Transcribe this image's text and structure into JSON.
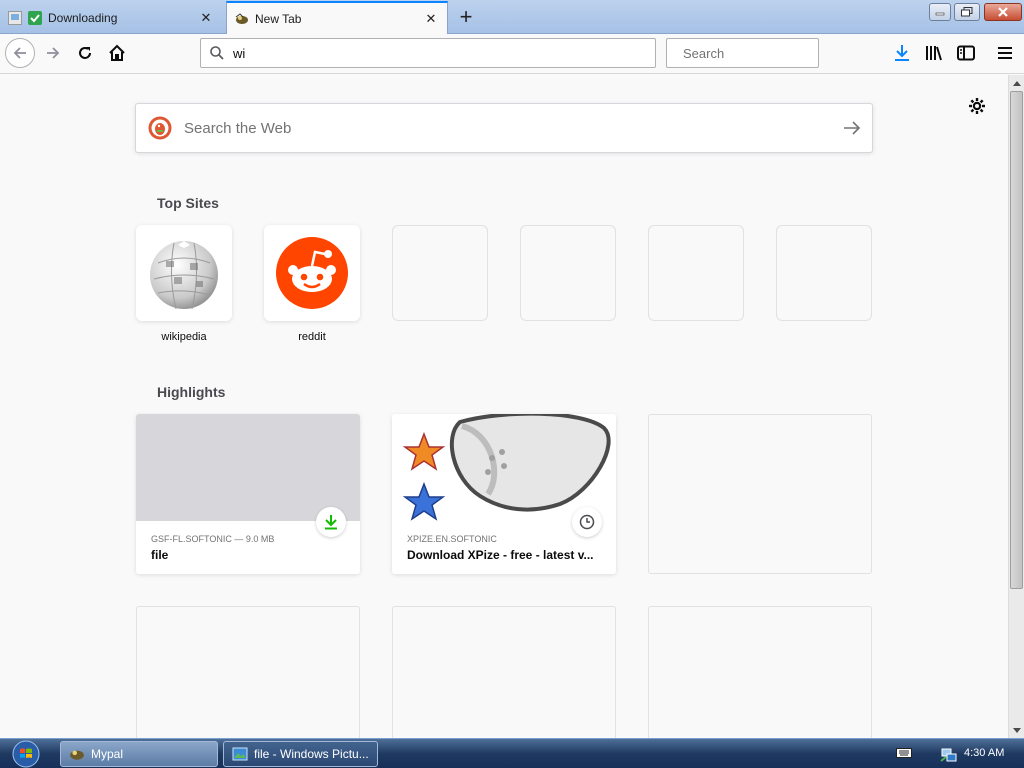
{
  "browser": {
    "tabs": [
      {
        "label": "Downloading",
        "close": "✕"
      },
      {
        "label": "New Tab",
        "close": "✕"
      }
    ],
    "new_tab_glyph": "+",
    "url_value": "wi",
    "search_placeholder": "Search",
    "accent": "#0a84ff"
  },
  "page": {
    "web_search_placeholder": "Search the Web",
    "topsites_title": "Top Sites",
    "topsites": [
      {
        "label": "wikipedia",
        "icon": "wikipedia-globe-icon"
      },
      {
        "label": "reddit",
        "icon": "reddit-alien-icon",
        "color": "#ff4500"
      },
      {
        "label": ""
      },
      {
        "label": ""
      },
      {
        "label": ""
      },
      {
        "label": ""
      }
    ],
    "highlights_title": "Highlights",
    "highlights": [
      {
        "meta": "GSF-FL.SOFTONIC — 9.0 MB",
        "title": "file",
        "badge": "download-icon",
        "badge_color": "#12bc00"
      },
      {
        "meta": "XPIZE.EN.SOFTONIC",
        "title": "Download XPize - free - latest v...",
        "badge": "clock-icon"
      },
      {
        "meta": "",
        "title": ""
      }
    ]
  },
  "taskbar": {
    "items": [
      {
        "label": "Mypal"
      },
      {
        "label": "file - Windows Pictu..."
      }
    ],
    "clock": "4:30 AM"
  }
}
